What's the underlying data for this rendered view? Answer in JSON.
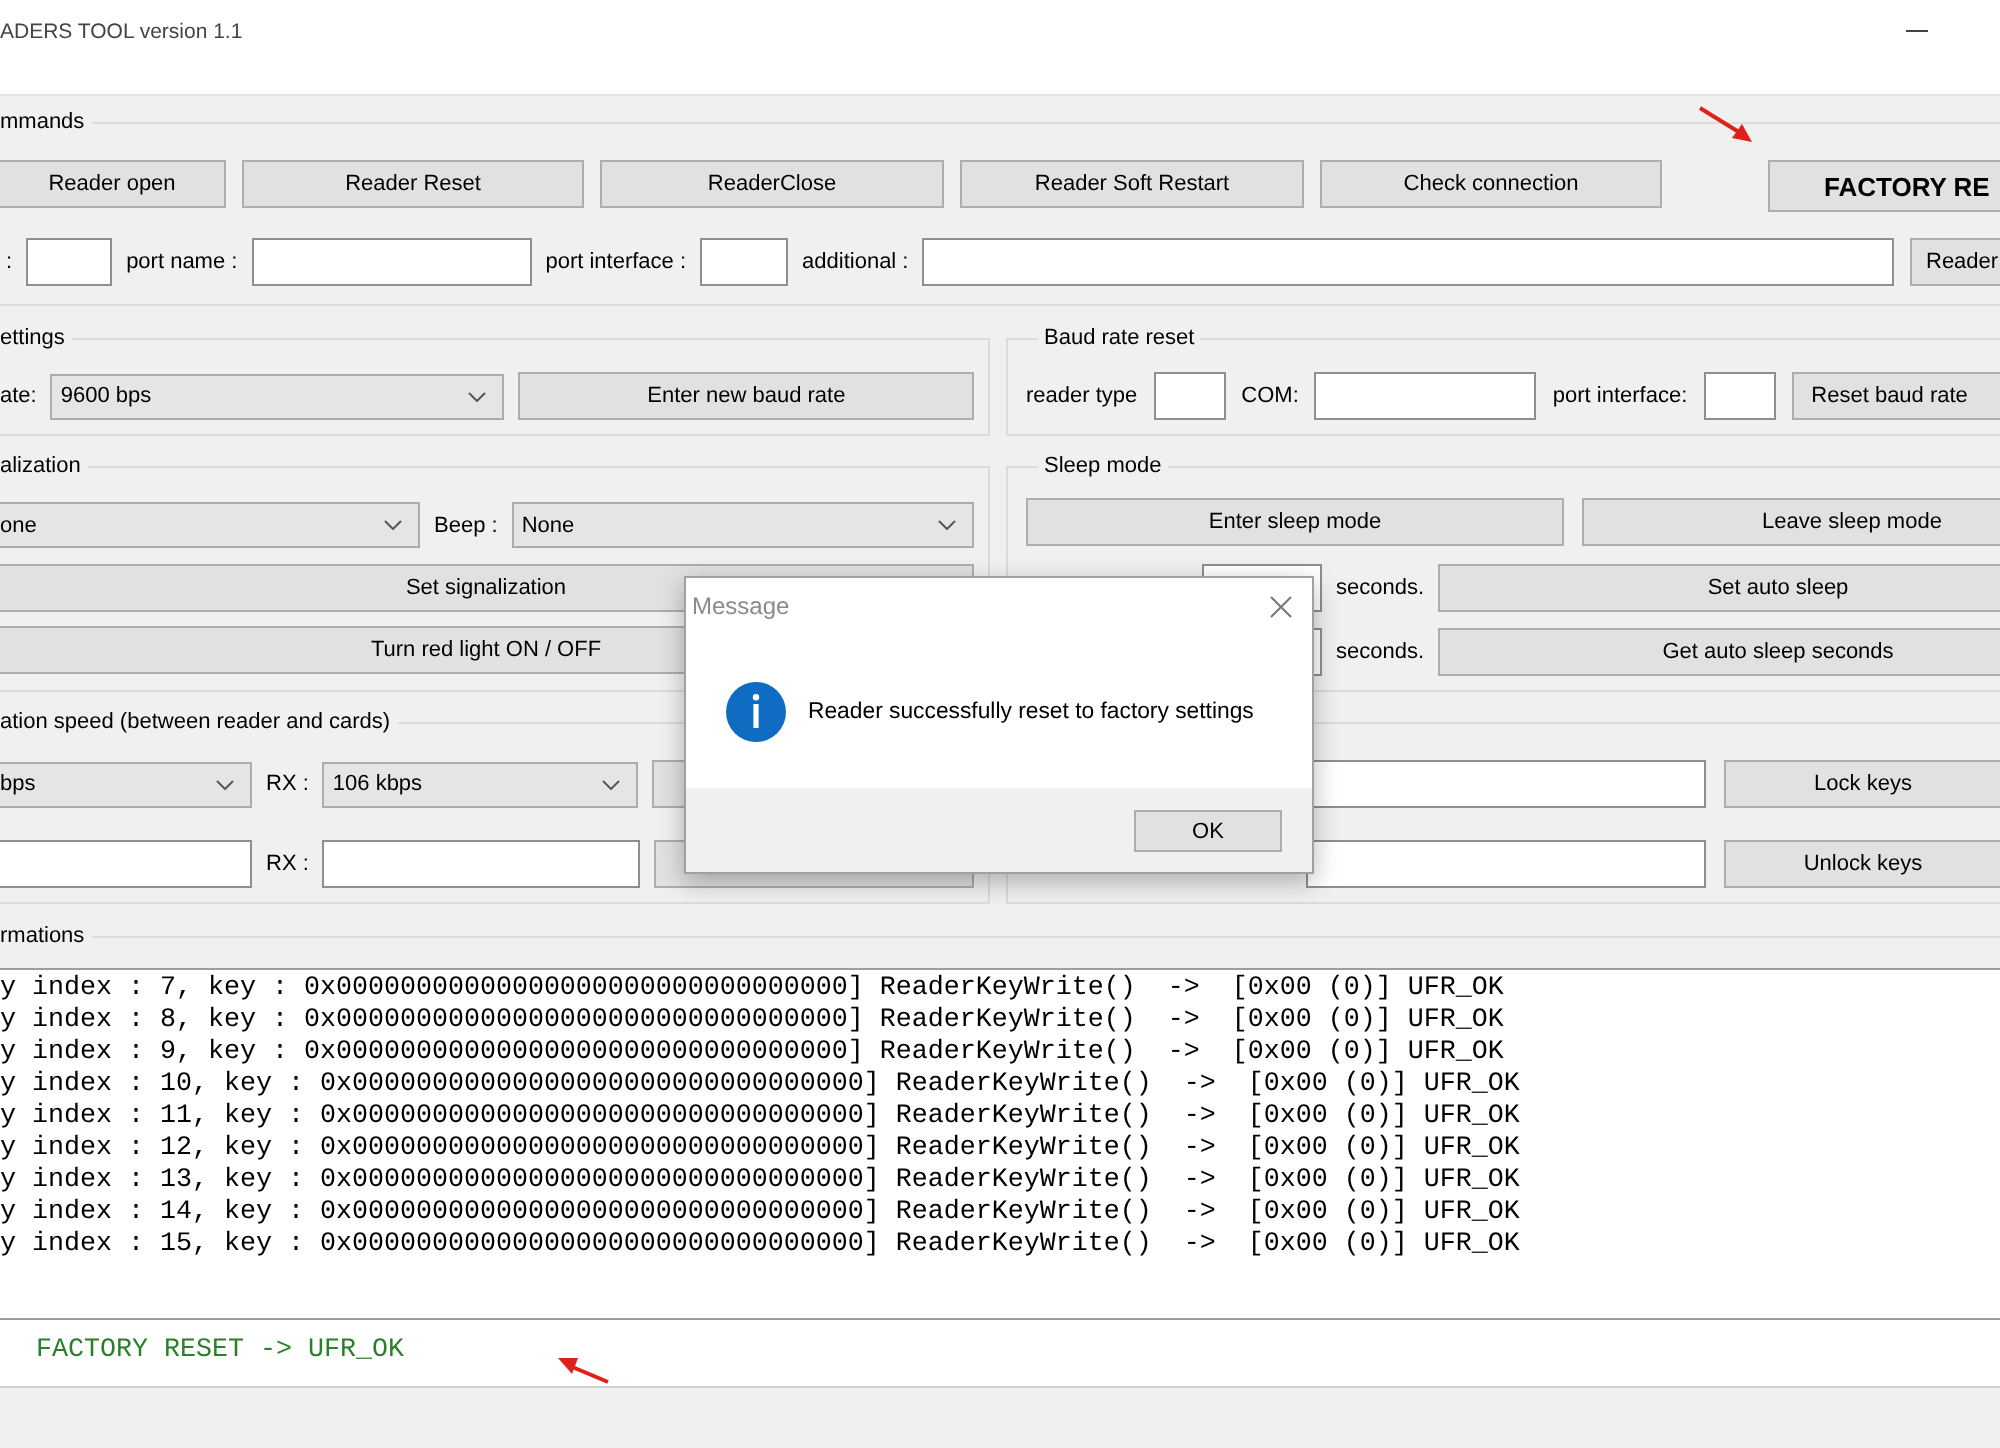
{
  "window": {
    "title": "ADERS TOOL version 1.1"
  },
  "commands": {
    "title": "mmands",
    "buttons": [
      {
        "label": "Reader open",
        "kind": "normal"
      },
      {
        "label": "Reader Reset",
        "kind": "normal"
      },
      {
        "label": "ReaderClose",
        "kind": "normal"
      },
      {
        "label": "Reader Soft Restart",
        "kind": "normal"
      },
      {
        "label": "Check connection",
        "kind": "normal"
      },
      {
        "label": "FACTORY RE",
        "kind": "emphasis"
      }
    ],
    "port_fields": [
      {
        "label": ":"
      },
      {
        "label": "port name :"
      },
      {
        "label": "port interface :"
      },
      {
        "label": "additional :"
      }
    ],
    "port_button": "Reader"
  },
  "settings": {
    "title": "ettings",
    "rate_label": "ate:",
    "rate": "9600 bps",
    "button": "Enter new baud rate"
  },
  "baud_rate_reset": {
    "title": "Baud rate reset",
    "fields": [
      {
        "label": "reader type"
      },
      {
        "label": "COM:"
      },
      {
        "label": "port interface:"
      }
    ],
    "button": "Reset baud rate"
  },
  "signalization": {
    "title": "alization",
    "light": "one",
    "beep_label": "Beep :",
    "beep": "None",
    "buttons": [
      "Set signalization",
      "Turn red light ON / OFF"
    ]
  },
  "sleep_mode": {
    "title": "Sleep mode",
    "buttons": [
      "Enter sleep mode",
      "Leave sleep mode"
    ],
    "rows": [
      {
        "unit": "seconds.",
        "button": "Set auto sleep"
      },
      {
        "unit": "seconds.",
        "button": "Get auto sleep seconds"
      }
    ]
  },
  "speed": {
    "title": "ation speed (between reader and cards)",
    "tx": "bps",
    "rx_label": "RX :",
    "rx": "106 kbps",
    "rx_label_2": "RX :"
  },
  "keys": {
    "buttons": [
      "Lock keys",
      "Unlock keys"
    ]
  },
  "informations": {
    "title": "rmations",
    "log": [
      "y index : 7, key : 0x00000000000000000000000000000000] ReaderKeyWrite()  ->  [0x00 (0)] UFR_OK",
      "y index : 8, key : 0x00000000000000000000000000000000] ReaderKeyWrite()  ->  [0x00 (0)] UFR_OK",
      "y index : 9, key : 0x00000000000000000000000000000000] ReaderKeyWrite()  ->  [0x00 (0)] UFR_OK",
      "y index : 10, key : 0x00000000000000000000000000000000] ReaderKeyWrite()  ->  [0x00 (0)] UFR_OK",
      "y index : 11, key : 0x00000000000000000000000000000000] ReaderKeyWrite()  ->  [0x00 (0)] UFR_OK",
      "y index : 12, key : 0x00000000000000000000000000000000] ReaderKeyWrite()  ->  [0x00 (0)] UFR_OK",
      "y index : 13, key : 0x00000000000000000000000000000000] ReaderKeyWrite()  ->  [0x00 (0)] UFR_OK",
      "y index : 14, key : 0x00000000000000000000000000000000] ReaderKeyWrite()  ->  [0x00 (0)] UFR_OK",
      "y index : 15, key : 0x00000000000000000000000000000000] ReaderKeyWrite()  ->  [0x00 (0)] UFR_OK"
    ],
    "result": "FACTORY RESET -> UFR_OK"
  },
  "dialog": {
    "title": "Message",
    "message": "Reader successfully reset to factory settings",
    "button": "OK"
  }
}
